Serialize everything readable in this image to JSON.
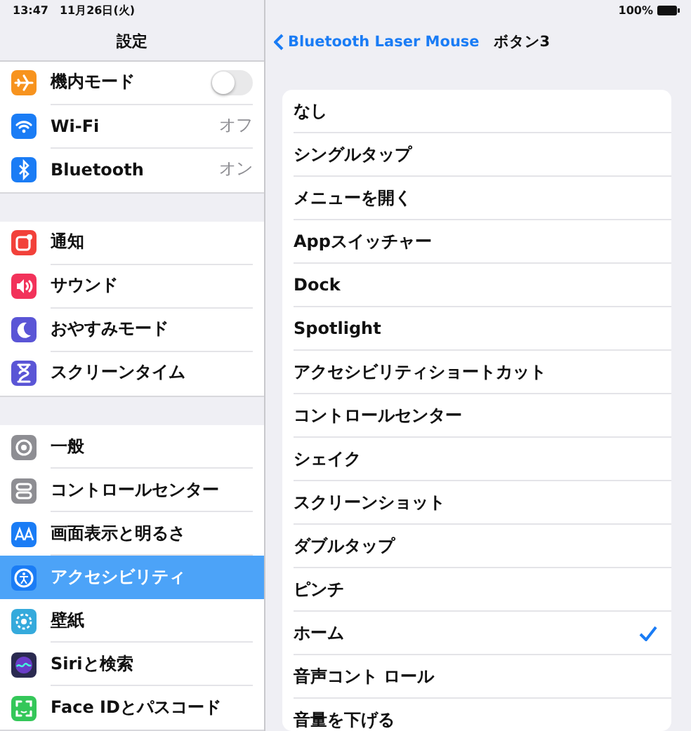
{
  "status_bar": {
    "time": "13:47",
    "date": "11月26日(火)",
    "battery": "100%"
  },
  "sidebar": {
    "title": "設定",
    "groups": [
      [
        {
          "label": "機内モード",
          "kind": "toggle",
          "on": false,
          "color": "#f7931e",
          "selected": false
        },
        {
          "label": "Wi-Fi",
          "kind": "value",
          "value": "オフ",
          "color": "#1a7cf5",
          "selected": false
        },
        {
          "label": "Bluetooth",
          "kind": "value",
          "value": "オン",
          "color": "#1a7cf5",
          "selected": false
        }
      ],
      [
        {
          "label": "通知",
          "kind": "plain",
          "color": "#f2413a",
          "selected": false
        },
        {
          "label": "サウンド",
          "kind": "plain",
          "color": "#f2325a",
          "selected": false
        },
        {
          "label": "おやすみモード",
          "kind": "plain",
          "color": "#5a55d6",
          "selected": false
        },
        {
          "label": "スクリーンタイム",
          "kind": "plain",
          "color": "#5a55d6",
          "selected": false
        }
      ],
      [
        {
          "label": "一般",
          "kind": "plain",
          "color": "#8e8e93",
          "selected": false
        },
        {
          "label": "コントロールセンター",
          "kind": "plain",
          "color": "#8e8e93",
          "selected": false
        },
        {
          "label": "画面表示と明るさ",
          "kind": "plain",
          "color": "#1a7cf5",
          "selected": false
        },
        {
          "label": "アクセシビリティ",
          "kind": "plain",
          "color": "#1a7cf5",
          "selected": true
        },
        {
          "label": "壁紙",
          "kind": "plain",
          "color": "#35aadc",
          "selected": false
        },
        {
          "label": "Siriと検索",
          "kind": "plain",
          "color": "#2a2a50",
          "selected": false
        },
        {
          "label": "Face IDとパスコード",
          "kind": "plain",
          "color": "#34c759",
          "selected": false
        }
      ]
    ]
  },
  "detail": {
    "back": "Bluetooth Laser Mouse",
    "title": "ボタン3",
    "options": [
      {
        "label": "なし",
        "selected": false
      },
      {
        "label": "シングルタップ",
        "selected": false
      },
      {
        "label": "メニューを開く",
        "selected": false
      },
      {
        "label": "Appスイッチャー",
        "selected": false
      },
      {
        "label": "Dock",
        "selected": false
      },
      {
        "label": "Spotlight",
        "selected": false
      },
      {
        "label": "アクセシビリティショートカット",
        "selected": false
      },
      {
        "label": "コントロールセンター",
        "selected": false
      },
      {
        "label": "シェイク",
        "selected": false
      },
      {
        "label": "スクリーンショット",
        "selected": false
      },
      {
        "label": "ダブルタップ",
        "selected": false
      },
      {
        "label": "ピンチ",
        "selected": false
      },
      {
        "label": "ホーム",
        "selected": true
      },
      {
        "label": "音声コント ロール",
        "selected": false
      },
      {
        "label": "音量を下げる",
        "selected": false
      }
    ]
  }
}
